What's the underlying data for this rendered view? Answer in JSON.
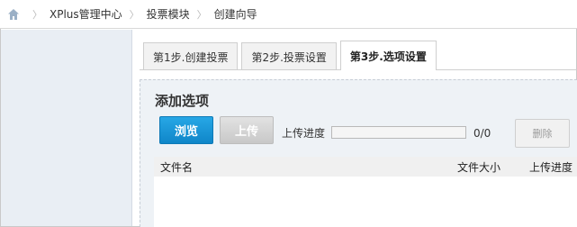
{
  "breadcrumb": {
    "home_icon": "home-icon",
    "items": [
      "XPlus管理中心",
      "投票模块",
      "创建向导"
    ]
  },
  "tabs": [
    {
      "label": "第1步.创建投票",
      "active": false
    },
    {
      "label": "第2步.投票设置",
      "active": false
    },
    {
      "label": "第3步.选项设置",
      "active": true
    }
  ],
  "panel": {
    "title": "添加选项",
    "browse_label": "浏览",
    "upload_label": "上传",
    "progress_label": "上传进度",
    "progress_fraction": 0,
    "progress_count": "0/0",
    "delete_label": "删除"
  },
  "file_table": {
    "columns": [
      "文件名",
      "文件大小",
      "上传进度"
    ],
    "rows": []
  },
  "colors": {
    "accent": "#1a96d8",
    "sidebar_bg": "#e9eef4",
    "panel_bg": "#eef2f6"
  }
}
